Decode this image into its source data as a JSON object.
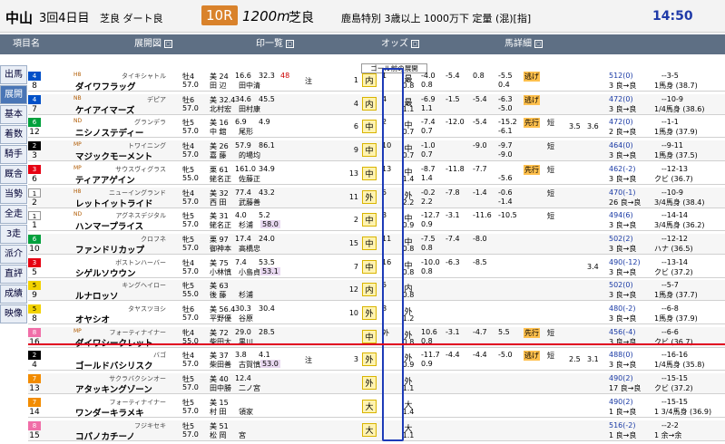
{
  "header": {
    "venue": "中山",
    "meeting": "3回4日目",
    "track": "芝良 ダート良",
    "race": "10R",
    "distance": "1200m",
    "condition": "芝良",
    "race_name": "鹿島特別  3歳以上 1000万下 定量 (混)[指]",
    "time": "14:50"
  },
  "sections": [
    {
      "label": "項目名"
    },
    {
      "label": "展開図"
    },
    {
      "label": "印一覧"
    },
    {
      "label": "オッズ"
    },
    {
      "label": "馬詳細"
    }
  ],
  "sidebar": {
    "items": [
      {
        "label": "出馬"
      },
      {
        "label": "展開"
      },
      {
        "label": "基本"
      },
      {
        "label": "着数"
      },
      {
        "label": "騎手"
      },
      {
        "label": "厩舎"
      },
      {
        "label": "当勢"
      },
      {
        "label": "全走"
      },
      {
        "label": "3走"
      },
      {
        "label": "派介"
      },
      {
        "label": "直評"
      },
      {
        "label": "成績"
      },
      {
        "label": "映像"
      }
    ]
  },
  "popup": "ゴール前の展開",
  "colors": {
    "accent": "#1d3bb8",
    "redline": "#e00020",
    "header": "#5e6f84"
  },
  "rows": [
    {
      "wk": "4",
      "um": "8",
      "ab": "H8",
      "sire": "タイキシャトル",
      "name": "ダイワフラッグ",
      "sx": "牡4",
      "wt": "57.0",
      "tr": "美 24",
      "jk": "田 辺",
      "n1": "16.6",
      "n2": "32.3",
      "n3": "田中清",
      "n4": "",
      "pr": "48",
      "pr2": "",
      "mk": "注",
      "p1": "1",
      "p2": "",
      "tg": "内",
      "ps": "1",
      "ps2": "",
      "o1": "最",
      "o2": "0.8",
      "o3": "-4.0",
      "o4": "0.8",
      "o5": "-5.4",
      "o6": "",
      "o7": "0.8",
      "o8": "",
      "o9": "-5.5",
      "o10": "0.4",
      "o11": "逃げ",
      "o12": "",
      "d1": "",
      "d2": "",
      "d3": "",
      "d4": "",
      "h1": "512(0)",
      "h2": "3  良→良",
      "h3": "--3-5",
      "h4": "1馬身 (38.7)"
    },
    {
      "wk": "4",
      "um": "7",
      "ab": "NB",
      "sire": "デピア",
      "name": "ケイアイマーズ",
      "sx": "牡6",
      "wt": "57.0",
      "tr": "美 32.4",
      "jk": "北村宏",
      "n1": "34.6",
      "n2": "45.5",
      "n3": "田村康",
      "n4": "",
      "pr": "",
      "pr2": "",
      "mk": "",
      "p1": "4",
      "p2": "",
      "tg": "内",
      "ps": "4",
      "ps2": "",
      "o1": "最",
      "o2": "1.1",
      "o3": "-6.9",
      "o4": "1.1",
      "o5": "-1.5",
      "o6": "",
      "o7": "-5.4",
      "o8": "",
      "o9": "-6.3",
      "o10": "-5.0",
      "o11": "逃げ",
      "o12": "",
      "d1": "",
      "d2": "",
      "d3": "",
      "d4": "",
      "h1": "472(0)",
      "h2": "3  良→良",
      "h3": "--10-9",
      "h4": "1/4馬身 (38.6)"
    },
    {
      "wk": "6",
      "um": "12",
      "ab": "ND",
      "sire": "グランデラ",
      "name": "ニシノステディー",
      "sx": "牡5",
      "wt": "57.0",
      "tr": "美 16",
      "jk": "中 舘",
      "n1": "6.9",
      "n2": "4.9",
      "n3": "尾形",
      "n4": "",
      "pr": "",
      "pr2": "",
      "mk": "",
      "p1": "6",
      "p2": "",
      "tg": "中",
      "ps": "2",
      "ps2": "",
      "o1": "中",
      "o2": "0.7",
      "o3": "-7.4",
      "o4": "0.7",
      "o5": "-12.0",
      "o6": "",
      "o7": "-5.4",
      "o8": "",
      "o9": "-15.2",
      "o10": "-6.1",
      "o11": "先行",
      "o12": "",
      "d1": "短",
      "d2": "",
      "d3": "3.5",
      "d4": "3.6",
      "h1": "472(0)",
      "h2": "2  良→良",
      "h3": "--1-1",
      "h4": "1馬身 (37.9)"
    },
    {
      "wk": "2",
      "um": "3",
      "ab": "MP",
      "sire": "トワイニング",
      "name": "マジックモーメント",
      "sx": "牡4",
      "wt": "57.0",
      "tr": "美 26",
      "jk": "嘉 藤",
      "n1": "57.9",
      "n2": "86.1",
      "n3": "的場均",
      "n4": "",
      "pr": "",
      "pr2": "",
      "mk": "",
      "p1": "9",
      "p2": "",
      "tg": "中",
      "ps": "10",
      "ps2": "",
      "o1": "中",
      "o2": "0.7",
      "o3": "-1.0",
      "o4": "0.7",
      "o5": "",
      "o6": "",
      "o7": "-9.0",
      "o8": "",
      "o9": "-9.7",
      "o10": "-9.0",
      "o11": "",
      "o12": "",
      "d1": "短",
      "d2": "",
      "d3": "",
      "d4": "",
      "h1": "464(0)",
      "h2": "3  良→良",
      "h3": "--9-11",
      "h4": "1馬身 (37.5)"
    },
    {
      "wk": "3",
      "um": "6",
      "ab": "MP",
      "sire": "サウスヴィグラス",
      "name": "ティアアゲイン",
      "sx": "牝5",
      "wt": "55.0",
      "tr": "栗 61",
      "jk": "蛯名正",
      "n1": "161.0",
      "n2": "34.9",
      "n3": "佐藤正",
      "n4": "",
      "pr": "",
      "pr2": "",
      "mk": "",
      "p1": "13",
      "p2": "",
      "tg": "中",
      "ps": "13",
      "ps2": "",
      "o1": "中",
      "o2": "1.4",
      "o3": "-8.7",
      "o4": "1.4",
      "o5": "-11.8",
      "o6": "",
      "o7": "-7.7",
      "o8": "",
      "o9": "",
      "o10": "-5.6",
      "o11": "先行",
      "o12": "",
      "d1": "短",
      "d2": "",
      "d3": "",
      "d4": "",
      "h1": "462(-2)",
      "h2": "3  良→良",
      "h3": "--12-13",
      "h4": "クビ (36.7)"
    },
    {
      "wk": "1",
      "um": "2",
      "ab": "H8",
      "sire": "ニューイングランド",
      "name": "レットイットライド",
      "sx": "牡4",
      "wt": "57.0",
      "tr": "美 32",
      "jk": "西 田",
      "n1": "77.4",
      "n2": "43.2",
      "n3": "武藤善",
      "n4": "",
      "pr": "",
      "pr2": "",
      "mk": "",
      "p1": "11",
      "p2": "",
      "tg": "外",
      "ps": "5",
      "ps2": "",
      "o1": "外",
      "o2": "2.2",
      "o3": "-0.2",
      "o4": "2.2",
      "o5": "-7.8",
      "o6": "",
      "o7": "-1.4",
      "o8": "",
      "o9": "-0.6",
      "o10": "-1.4",
      "o11": "",
      "o12": "",
      "d1": "短",
      "d2": "",
      "d3": "",
      "d4": "",
      "h1": "470(-1)",
      "h2": "26  良→良",
      "h3": "--10-9",
      "h4": "3/4馬身 (38.4)"
    },
    {
      "wk": "1",
      "um": "1",
      "ab": "ND",
      "sire": "アグネスデジタル",
      "name": "ハンマープライス",
      "sx": "牡5",
      "wt": "57.0",
      "tr": "美 31",
      "jk": "蛯名正",
      "n1": "4.0",
      "n2": "5.2",
      "n3": "杉浦",
      "n4": "58.0",
      "pr": "",
      "pr2": "",
      "mk": "",
      "p1": "2",
      "p2": "",
      "tg": "中",
      "ps": "3",
      "ps2": "",
      "o1": "中",
      "o2": "0.9",
      "o3": "-12.7",
      "o4": "0.9",
      "o5": "-3.1",
      "o6": "",
      "o7": "-11.6",
      "o8": "",
      "o9": "-10.5",
      "o10": "",
      "o11": "",
      "o12": "",
      "d1": "短",
      "d2": "",
      "d3": "",
      "d4": "",
      "h1": "494(6)",
      "h2": "3  良→良",
      "h3": "--14-14",
      "h4": "3/4馬身 (36.2)"
    },
    {
      "wk": "6",
      "um": "10",
      "ab": "",
      "sire": "クロフネ",
      "name": "ファンドリカップ",
      "sx": "牝5",
      "wt": "57.0",
      "tr": "栗 97",
      "jk": "御神本",
      "n1": "17.4",
      "n2": "24.0",
      "n3": "高橋忠",
      "n4": "",
      "pr": "",
      "pr2": "",
      "mk": "",
      "p1": "15",
      "p2": "",
      "tg": "中",
      "ps": "11",
      "ps2": "",
      "o1": "中",
      "o2": "0.8",
      "o3": "-7.5",
      "o4": "0.8",
      "o5": "-7.4",
      "o6": "",
      "o7": "-8.0",
      "o8": "",
      "o9": "",
      "o10": "",
      "o11": "",
      "o12": "",
      "d1": "",
      "d2": "",
      "d3": "",
      "d4": "",
      "h1": "502(2)",
      "h2": "3  良→良",
      "h3": "--12-12",
      "h4": "ハナ (36.5)"
    },
    {
      "wk": "3",
      "um": "5",
      "ab": "",
      "sire": "ボストンハーバー",
      "name": "シゲルソウウン",
      "sx": "牡4",
      "wt": "57.0",
      "tr": "美 75",
      "jk": "小林慎",
      "n1": "7.4",
      "n2": "53.5",
      "n3": "小島貞",
      "n4": "53.1",
      "pr": "",
      "pr2": "",
      "mk": "",
      "p1": "7",
      "p2": "",
      "tg": "中",
      "ps": "16",
      "ps2": "",
      "o1": "中",
      "o2": "0.8",
      "o3": "-10.0",
      "o4": "0.8",
      "o5": "-6.3",
      "o6": "",
      "o7": "-8.5",
      "o8": "",
      "o9": "",
      "o10": "",
      "o11": "",
      "o12": "",
      "d1": "",
      "d2": "",
      "d3": "",
      "d4": "3.4",
      "h1": "490(-12)",
      "h2": "3  良→良",
      "h3": "--13-14",
      "h4": "クビ (37.2)"
    },
    {
      "wk": "5",
      "um": "9",
      "ab": "",
      "sire": "キングヘイロー",
      "name": "ルナロッソ",
      "sx": "牝5",
      "wt": "55.0",
      "tr": "美 63",
      "jk": "後 藤",
      "n1": "",
      "n2": "",
      "n3": "杉浦",
      "n4": "",
      "pr": "",
      "pr2": "",
      "mk": "",
      "p1": "12",
      "p2": "",
      "tg": "内",
      "ps": "5",
      "ps2": "",
      "o1": "内",
      "o2": "0.8",
      "o3": "",
      "o4": "",
      "o5": "",
      "o6": "",
      "o7": "",
      "o8": "",
      "o9": "",
      "o10": "",
      "o11": "",
      "o12": "",
      "d1": "",
      "d2": "",
      "d3": "",
      "d4": "",
      "h1": "502(0)",
      "h2": "3  良→良",
      "h3": "--5-7",
      "h4": "1馬身 (37.7)"
    },
    {
      "wk": "5",
      "um": "8",
      "ab": "",
      "sire": "タヤスツヨシ",
      "name": "オヤシオ",
      "sx": "牡6",
      "wt": "57.0",
      "tr": "美 56.4",
      "jk": "平野優",
      "n1": "30.3",
      "n2": "30.4",
      "n3": "谷原",
      "n4": "",
      "pr": "",
      "pr2": "",
      "mk": "",
      "p1": "10",
      "p2": "",
      "tg": "外",
      "ps": "8",
      "ps2": "",
      "o1": "外",
      "o2": "1.2",
      "o3": "",
      "o4": "",
      "o5": "",
      "o6": "",
      "o7": "",
      "o8": "",
      "o9": "",
      "o10": "",
      "o11": "",
      "o12": "",
      "d1": "",
      "d2": "",
      "d3": "",
      "d4": "",
      "h1": "480(-2)",
      "h2": "3  良→良",
      "h3": "--6-8",
      "h4": "1馬身 (37.9)"
    },
    {
      "wk": "8",
      "um": "16",
      "ab": "MP",
      "sire": "フォーティナイナー",
      "name": "ダイワシークレット",
      "sx": "牝4",
      "wt": "55.0",
      "tr": "美 72",
      "jk": "柴田大",
      "n1": "29.0",
      "n2": "28.5",
      "n3": "黒川",
      "n4": "",
      "pr": "",
      "pr2": "",
      "mk": "",
      "p1": "",
      "p2": "",
      "tg": "中",
      "ps": "外",
      "ps2": "",
      "o1": "外",
      "o2": "0.8",
      "o3": "10.6",
      "o4": "0.8",
      "o5": "-3.1",
      "o6": "",
      "o7": "-4.7",
      "o8": "",
      "o9": "5.5",
      "o10": "",
      "o11": "先行",
      "o12": "",
      "d1": "短",
      "d2": "",
      "d3": "",
      "d4": "",
      "h1": "456(-4)",
      "h2": "3  良→良",
      "h3": "--6-6",
      "h4": "クビ (36.7)"
    },
    {
      "wk": "2",
      "um": "4",
      "ab": "",
      "sire": "バゴ",
      "name": "ゴールドバシリスク",
      "sx": "牡4",
      "wt": "57.0",
      "tr": "美 37",
      "jk": "柴田善",
      "n1": "3.8",
      "n2": "4.1",
      "n3": "古賀慎",
      "n4": "53.0",
      "pr": "",
      "pr2": "",
      "mk": "注",
      "p1": "3",
      "p2": "",
      "tg": "外",
      "ps": "",
      "ps2": "",
      "o1": "外",
      "o2": "0.9",
      "o3": "-11.7",
      "o4": "0.9",
      "o5": "-4.4",
      "o6": "",
      "o7": "-4.4",
      "o8": "",
      "o9": "-5.0",
      "o10": "",
      "o11": "逃げ",
      "o12": "",
      "d1": "短",
      "d2": "",
      "d3": "2.5",
      "d4": "3.1",
      "h1": "488(0)",
      "h2": "3  良→良",
      "h3": "--16-16",
      "h4": "1/4馬身 (35.8)"
    },
    {
      "wk": "7",
      "um": "13",
      "ab": "",
      "sire": "サクラバクシンオー",
      "name": "アタッキングゾーン",
      "sx": "牡5",
      "wt": "57.0",
      "tr": "美 40",
      "jk": "田中勝",
      "n1": "12.4",
      "n2": "",
      "n3": "二ノ宮",
      "n4": "",
      "pr": "",
      "pr2": "",
      "mk": "",
      "p1": "",
      "p2": "",
      "tg": "外",
      "ps": "",
      "ps2": "",
      "o1": "外",
      "o2": "1.1",
      "o3": "",
      "o4": "",
      "o5": "",
      "o6": "",
      "o7": "",
      "o8": "",
      "o9": "",
      "o10": "",
      "o11": "",
      "o12": "",
      "d1": "",
      "d2": "",
      "d3": "",
      "d4": "",
      "h1": "490(2)",
      "h2": "17  良→良",
      "h3": "--15-15",
      "h4": "クビ (37.2)"
    },
    {
      "wk": "7",
      "um": "14",
      "ab": "",
      "sire": "フォーティナイナー",
      "name": "ワンダーキラメキ",
      "sx": "牡5",
      "wt": "57.0",
      "tr": "美 15",
      "jk": "村 田",
      "n1": "",
      "n2": "",
      "n3": "領家",
      "n4": "",
      "pr": "",
      "pr2": "",
      "mk": "",
      "p1": "",
      "p2": "",
      "tg": "大",
      "ps": "",
      "ps2": "",
      "o1": "大",
      "o2": "1.4",
      "o3": "",
      "o4": "",
      "o5": "",
      "o6": "",
      "o7": "",
      "o8": "",
      "o9": "",
      "o10": "",
      "o11": "",
      "o12": "",
      "d1": "",
      "d2": "",
      "d3": "",
      "d4": "",
      "h1": "490(2)",
      "h2": "1  良→良",
      "h3": "--15-15",
      "h4": "1 3/4馬身 (36.9)"
    },
    {
      "wk": "8",
      "um": "15",
      "ab": "",
      "sire": "フジキセキ",
      "name": "コパノカチーノ",
      "sx": "牡5",
      "wt": "57.0",
      "tr": "美 51",
      "jk": "松 岡",
      "n1": "",
      "n2": "",
      "n3": "宮",
      "n4": "",
      "pr": "",
      "pr2": "",
      "mk": "",
      "p1": "",
      "p2": "",
      "tg": "大",
      "ps": "",
      "ps2": "",
      "o1": "大",
      "o2": "1.1",
      "o3": "",
      "o4": "",
      "o5": "",
      "o6": "",
      "o7": "",
      "o8": "",
      "o9": "",
      "o10": "",
      "o11": "",
      "o12": "",
      "d1": "",
      "d2": "",
      "d3": "",
      "d4": "",
      "h1": "516(-2)",
      "h2": "1  良→良",
      "h3": "--2-2",
      "h4": "1 余→余"
    }
  ]
}
